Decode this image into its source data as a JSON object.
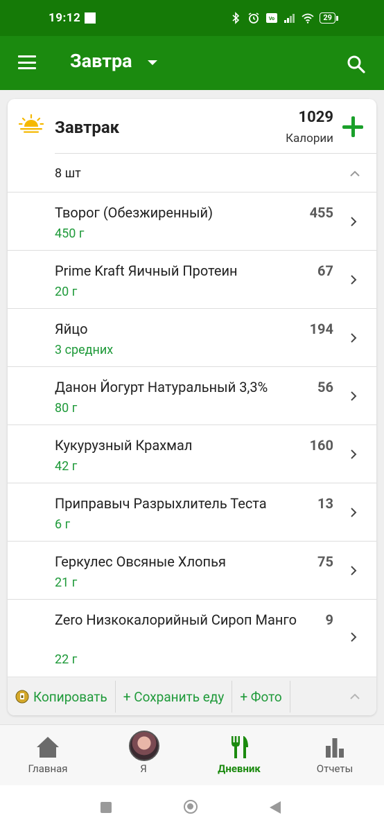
{
  "status_bar": {
    "time": "19:12",
    "battery": "29"
  },
  "app_bar": {
    "title": "Завтра"
  },
  "meal": {
    "name": "Завтрак",
    "calories": "1029",
    "calories_label": "Калории",
    "count_label": "8 шт",
    "items": [
      {
        "name": "Творог (Обезжиренный)",
        "amount": "450 г",
        "calories": "455"
      },
      {
        "name": "Prime Kraft Яичный Протеин",
        "amount": "20 г",
        "calories": "67"
      },
      {
        "name": "Яйцо",
        "amount": "3 средних",
        "calories": "194"
      },
      {
        "name": "Данон Йогурт Натуральный 3,3%",
        "amount": "80 г",
        "calories": "56"
      },
      {
        "name": "Кукурузный Крахмал",
        "amount": "42 г",
        "calories": "160"
      },
      {
        "name": "Приправыч Разрыхлитель Теста",
        "amount": "6 г",
        "calories": "13"
      },
      {
        "name": "Геркулес Овсяные Хлопья",
        "amount": "21 г",
        "calories": "75"
      },
      {
        "name": "Zero Низкокалорийный Сироп Манго",
        "amount": "22 г",
        "calories": "9"
      }
    ],
    "footer": {
      "copy": "Копировать",
      "save": "+ Сохранить еду",
      "photo": "+ Фото"
    }
  },
  "bottom_nav": {
    "items": [
      {
        "label": "Главная"
      },
      {
        "label": "Я"
      },
      {
        "label": "Дневник"
      },
      {
        "label": "Отчеты"
      }
    ]
  },
  "colors": {
    "status_bar": "#157a07",
    "app_bar": "#1b8a0f",
    "accent_green": "#1f9a3a",
    "add_green": "#1aa02a"
  }
}
